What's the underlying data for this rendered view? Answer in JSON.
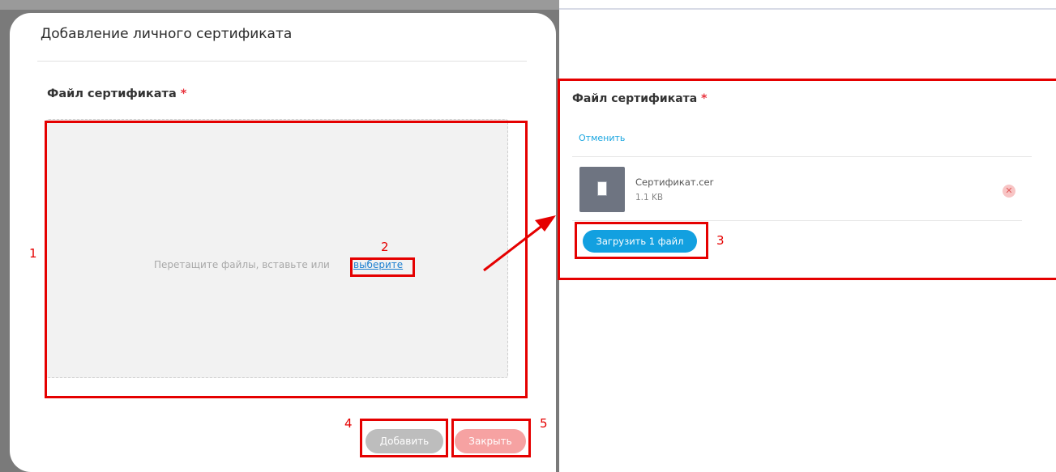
{
  "backdrop": {
    "header_fragment": "..."
  },
  "modal": {
    "title": "Добавление личного сертификата",
    "field_label": "Файл сертификата",
    "required_mark": "*",
    "dropzone_text": "Перетащите файлы, вставьте или",
    "dropzone_link": "выберите",
    "add_button": "Добавить",
    "close_button": "Закрыть"
  },
  "upload_panel": {
    "field_label": "Файл сертификата",
    "required_mark": "*",
    "cancel_link": "Отменить",
    "file": {
      "name": "Сертификат.cer",
      "size": "1.1 KB"
    },
    "remove_icon": "close-circle-icon",
    "upload_button": "Загрузить 1 файл"
  },
  "annotations": {
    "n1": "1",
    "n2": "2",
    "n3": "3",
    "n4": "4",
    "n5": "5",
    "color": "#e50000"
  },
  "colors": {
    "accent_blue": "#12a0e0",
    "link_blue": "#1c7fd0",
    "close_pink": "#f6a2a2",
    "add_gray": "#bdbdbd"
  }
}
